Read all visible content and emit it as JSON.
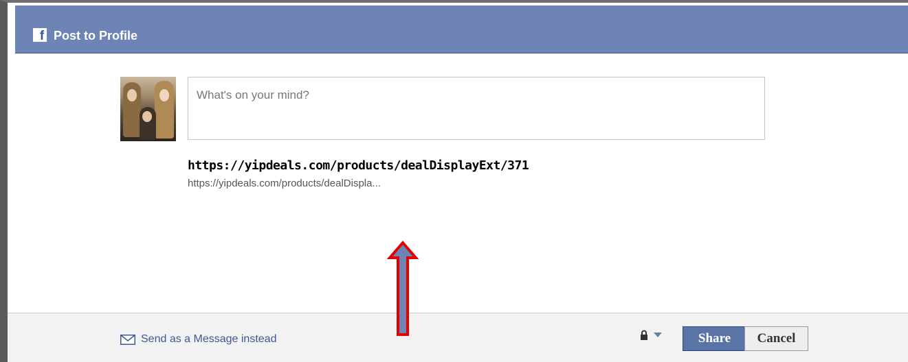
{
  "dialog": {
    "title": "Post to Profile",
    "icon": "facebook-f-icon",
    "brand_color": "#6d84b4"
  },
  "composer": {
    "placeholder": "What's on your mind?",
    "avatar": "user-avatar-photo"
  },
  "link_preview": {
    "title": "https://yipdeals.com/products/dealDisplayExt/371",
    "url": "https://yipdeals.com/products/dealDispla..."
  },
  "footer": {
    "message_link": "Send as a Message instead",
    "message_icon": "envelope-icon",
    "privacy_icon": "lock-icon",
    "share_label": "Share",
    "cancel_label": "Cancel"
  },
  "annotation": {
    "type": "arrow-up",
    "fill_color": "#6d84b4",
    "outline_color": "#e00000"
  }
}
